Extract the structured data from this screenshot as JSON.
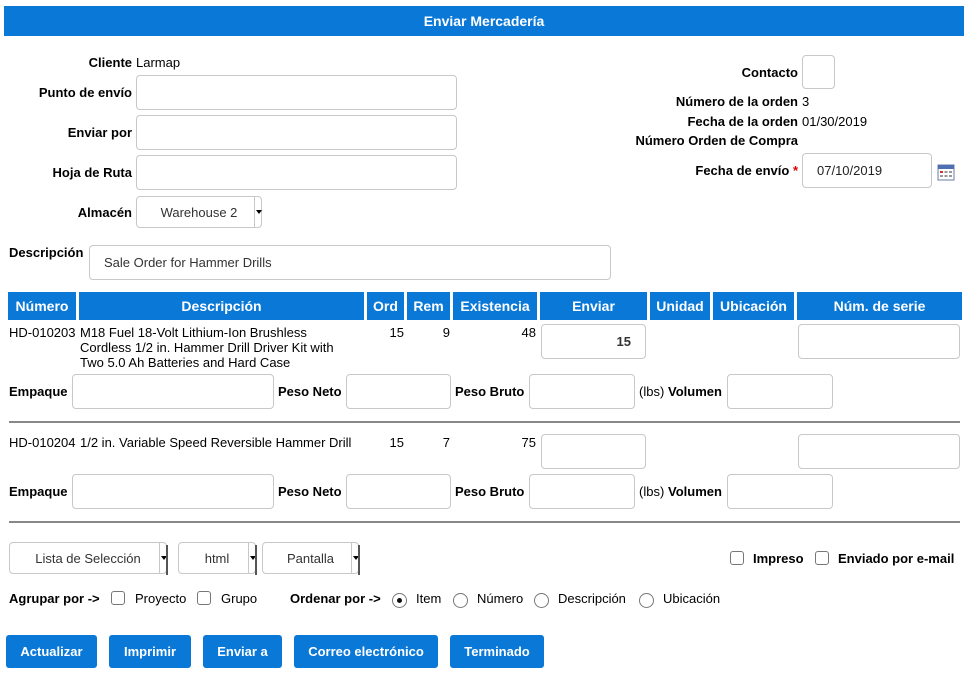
{
  "title": "Enviar Mercadería",
  "header": {
    "cliente_label": "Cliente",
    "cliente_value": "Larmap",
    "punto_envio_label": "Punto de envío",
    "punto_envio_value": "",
    "enviar_por_label": "Enviar por",
    "enviar_por_value": "",
    "hoja_ruta_label": "Hoja de Ruta",
    "hoja_ruta_value": "",
    "almacen_label": "Almacén",
    "almacen_value": "Warehouse 2",
    "contacto_label": "Contacto",
    "numero_orden_label": "Número de la orden",
    "numero_orden_value": "3",
    "fecha_orden_label": "Fecha de la orden",
    "fecha_orden_value": "01/30/2019",
    "orden_compra_label": "Número Orden de Compra",
    "orden_compra_value": "",
    "fecha_envio_label": "Fecha de envío",
    "required_mark": "*",
    "fecha_envio_value": "07/10/2019",
    "descripcion_label": "Descripción",
    "descripcion_value": "Sale Order for Hammer Drills"
  },
  "table": {
    "columns": [
      "Número",
      "Descripción",
      "Ord",
      "Rem",
      "Existencia",
      "Enviar",
      "Unidad",
      "Ubicación",
      "Núm. de serie"
    ],
    "rows": [
      {
        "numero": "HD-010203",
        "descripcion_lines": [
          "M18 Fuel 18-Volt Lithium-Ion Brushless",
          "Cordless 1/2 in. Hammer Drill Driver Kit with",
          "Two 5.0 Ah Batteries and Hard Case"
        ],
        "ord": "15",
        "rem": "9",
        "existencia": "48",
        "enviar": "15",
        "serie": ""
      },
      {
        "numero": "HD-010204",
        "descripcion_lines": [
          "1/2 in. Variable Speed Reversible Hammer Drill"
        ],
        "ord": "15",
        "rem": "7",
        "existencia": "75",
        "enviar": "",
        "serie": ""
      }
    ],
    "empaque_label": "Empaque",
    "peso_neto_label": "Peso Neto",
    "peso_bruto_label": "Peso Bruto",
    "lbs_label": "(lbs)",
    "volumen_label": "Volumen"
  },
  "options": {
    "format_select": "Lista de Selección",
    "type_select": "html",
    "output_select": "Pantalla",
    "impreso_label": "Impreso",
    "email_label": "Enviado por e-mail",
    "agrupar_label": "Agrupar por ->",
    "proyecto_label": "Proyecto",
    "grupo_label": "Grupo",
    "ordenar_label": "Ordenar por ->",
    "sort_options": [
      "Item",
      "Número",
      "Descripción",
      "Ubicación"
    ]
  },
  "buttons": [
    "Actualizar",
    "Imprimir",
    "Enviar a",
    "Correo electrónico",
    "Terminado"
  ],
  "colors": {
    "accent": "#0a78d7"
  }
}
